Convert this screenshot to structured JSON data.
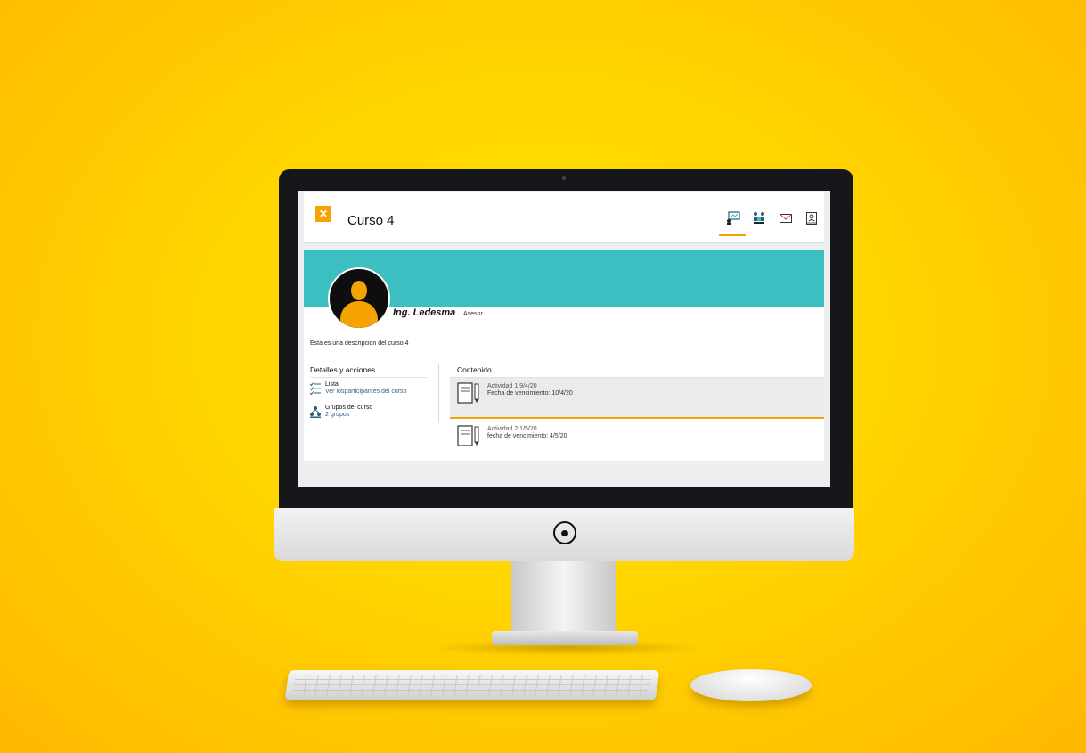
{
  "header": {
    "close_label": "✕",
    "course_title": "Curso 4"
  },
  "nav_icons": [
    {
      "name": "presentation-icon",
      "active": true
    },
    {
      "name": "group-meeting-icon",
      "active": false
    },
    {
      "name": "mail-icon",
      "active": false
    },
    {
      "name": "contact-book-icon",
      "active": false
    }
  ],
  "profile": {
    "teacher_name": "Ing. Ledesma",
    "teacher_role": "Asesor",
    "description": "Esta es una descripcion del curso 4"
  },
  "details": {
    "title": "Detalles y acciones",
    "items": [
      {
        "label": "Lista",
        "sub": "Ver losparticipantes del curso",
        "icon": "checklist-icon"
      },
      {
        "label": "Grupos del curso",
        "sub": "2 grupos",
        "icon": "hierarchy-icon"
      }
    ]
  },
  "contenido": {
    "title": "Contenido",
    "activities": [
      {
        "title": "Actividad 1 9/4/20",
        "due": "Fecha de vencimiento: 10/4/20",
        "icon": "notebook-pencil-icon",
        "selected": true
      },
      {
        "title": "Actividad 2 1/5/20",
        "due": "fecha de vencimiento: 4/5/20",
        "icon": "notebook-pencil-icon",
        "selected": false
      }
    ]
  },
  "colors": {
    "accent": "#f5a300",
    "banner": "#3bbfc1",
    "background": "#ffd400"
  }
}
